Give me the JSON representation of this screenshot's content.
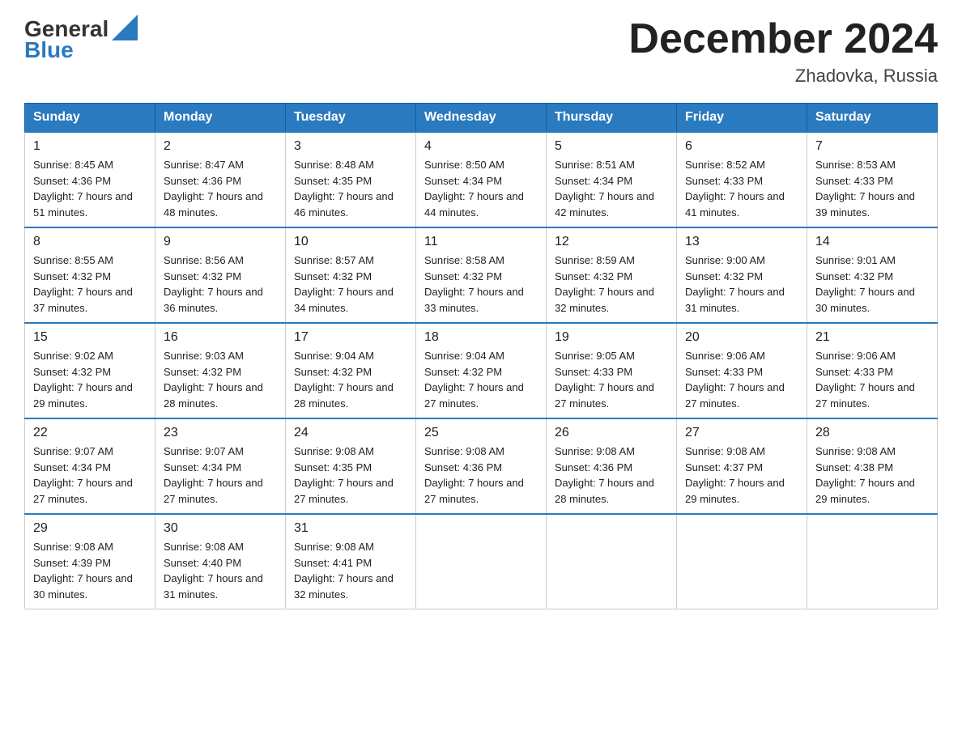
{
  "header": {
    "logo_text_general": "General",
    "logo_text_blue": "Blue",
    "month_title": "December 2024",
    "location": "Zhadovka, Russia"
  },
  "days_of_week": [
    "Sunday",
    "Monday",
    "Tuesday",
    "Wednesday",
    "Thursday",
    "Friday",
    "Saturday"
  ],
  "weeks": [
    [
      {
        "day": "1",
        "sunrise": "8:45 AM",
        "sunset": "4:36 PM",
        "daylight": "7 hours and 51 minutes."
      },
      {
        "day": "2",
        "sunrise": "8:47 AM",
        "sunset": "4:36 PM",
        "daylight": "7 hours and 48 minutes."
      },
      {
        "day": "3",
        "sunrise": "8:48 AM",
        "sunset": "4:35 PM",
        "daylight": "7 hours and 46 minutes."
      },
      {
        "day": "4",
        "sunrise": "8:50 AM",
        "sunset": "4:34 PM",
        "daylight": "7 hours and 44 minutes."
      },
      {
        "day": "5",
        "sunrise": "8:51 AM",
        "sunset": "4:34 PM",
        "daylight": "7 hours and 42 minutes."
      },
      {
        "day": "6",
        "sunrise": "8:52 AM",
        "sunset": "4:33 PM",
        "daylight": "7 hours and 41 minutes."
      },
      {
        "day": "7",
        "sunrise": "8:53 AM",
        "sunset": "4:33 PM",
        "daylight": "7 hours and 39 minutes."
      }
    ],
    [
      {
        "day": "8",
        "sunrise": "8:55 AM",
        "sunset": "4:32 PM",
        "daylight": "7 hours and 37 minutes."
      },
      {
        "day": "9",
        "sunrise": "8:56 AM",
        "sunset": "4:32 PM",
        "daylight": "7 hours and 36 minutes."
      },
      {
        "day": "10",
        "sunrise": "8:57 AM",
        "sunset": "4:32 PM",
        "daylight": "7 hours and 34 minutes."
      },
      {
        "day": "11",
        "sunrise": "8:58 AM",
        "sunset": "4:32 PM",
        "daylight": "7 hours and 33 minutes."
      },
      {
        "day": "12",
        "sunrise": "8:59 AM",
        "sunset": "4:32 PM",
        "daylight": "7 hours and 32 minutes."
      },
      {
        "day": "13",
        "sunrise": "9:00 AM",
        "sunset": "4:32 PM",
        "daylight": "7 hours and 31 minutes."
      },
      {
        "day": "14",
        "sunrise": "9:01 AM",
        "sunset": "4:32 PM",
        "daylight": "7 hours and 30 minutes."
      }
    ],
    [
      {
        "day": "15",
        "sunrise": "9:02 AM",
        "sunset": "4:32 PM",
        "daylight": "7 hours and 29 minutes."
      },
      {
        "day": "16",
        "sunrise": "9:03 AM",
        "sunset": "4:32 PM",
        "daylight": "7 hours and 28 minutes."
      },
      {
        "day": "17",
        "sunrise": "9:04 AM",
        "sunset": "4:32 PM",
        "daylight": "7 hours and 28 minutes."
      },
      {
        "day": "18",
        "sunrise": "9:04 AM",
        "sunset": "4:32 PM",
        "daylight": "7 hours and 27 minutes."
      },
      {
        "day": "19",
        "sunrise": "9:05 AM",
        "sunset": "4:33 PM",
        "daylight": "7 hours and 27 minutes."
      },
      {
        "day": "20",
        "sunrise": "9:06 AM",
        "sunset": "4:33 PM",
        "daylight": "7 hours and 27 minutes."
      },
      {
        "day": "21",
        "sunrise": "9:06 AM",
        "sunset": "4:33 PM",
        "daylight": "7 hours and 27 minutes."
      }
    ],
    [
      {
        "day": "22",
        "sunrise": "9:07 AM",
        "sunset": "4:34 PM",
        "daylight": "7 hours and 27 minutes."
      },
      {
        "day": "23",
        "sunrise": "9:07 AM",
        "sunset": "4:34 PM",
        "daylight": "7 hours and 27 minutes."
      },
      {
        "day": "24",
        "sunrise": "9:08 AM",
        "sunset": "4:35 PM",
        "daylight": "7 hours and 27 minutes."
      },
      {
        "day": "25",
        "sunrise": "9:08 AM",
        "sunset": "4:36 PM",
        "daylight": "7 hours and 27 minutes."
      },
      {
        "day": "26",
        "sunrise": "9:08 AM",
        "sunset": "4:36 PM",
        "daylight": "7 hours and 28 minutes."
      },
      {
        "day": "27",
        "sunrise": "9:08 AM",
        "sunset": "4:37 PM",
        "daylight": "7 hours and 29 minutes."
      },
      {
        "day": "28",
        "sunrise": "9:08 AM",
        "sunset": "4:38 PM",
        "daylight": "7 hours and 29 minutes."
      }
    ],
    [
      {
        "day": "29",
        "sunrise": "9:08 AM",
        "sunset": "4:39 PM",
        "daylight": "7 hours and 30 minutes."
      },
      {
        "day": "30",
        "sunrise": "9:08 AM",
        "sunset": "4:40 PM",
        "daylight": "7 hours and 31 minutes."
      },
      {
        "day": "31",
        "sunrise": "9:08 AM",
        "sunset": "4:41 PM",
        "daylight": "7 hours and 32 minutes."
      },
      null,
      null,
      null,
      null
    ]
  ]
}
